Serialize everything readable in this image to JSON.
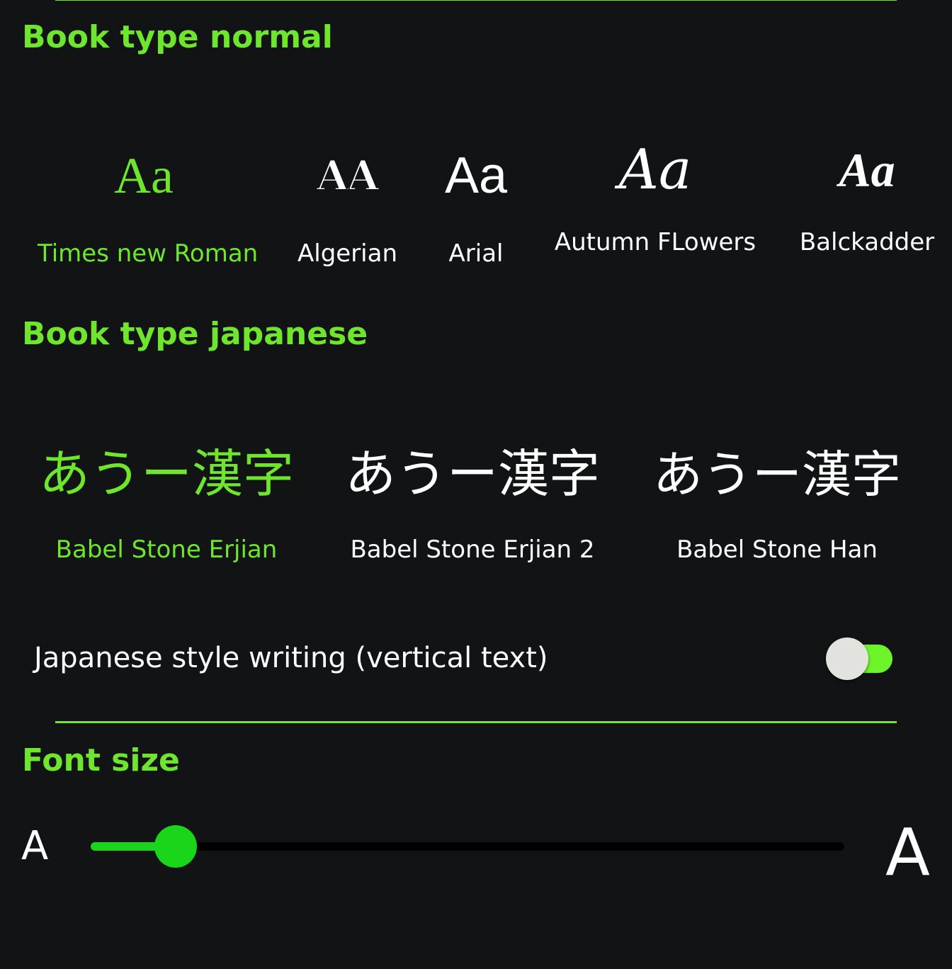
{
  "book_type_normal": {
    "title": "Book type normal",
    "options": [
      {
        "sample": "Aa",
        "label": "Times new Roman",
        "selected": true
      },
      {
        "sample": "AA",
        "label": "Algerian",
        "selected": false
      },
      {
        "sample": "Aa",
        "label": "Arial",
        "selected": false
      },
      {
        "sample": "Aa",
        "label": "Autumn FLowers",
        "selected": false
      },
      {
        "sample": "Aa",
        "label": "Balckadder",
        "selected": false
      }
    ]
  },
  "book_type_japanese": {
    "title": "Book type japanese",
    "options": [
      {
        "sample": "あうー漢字",
        "label": "Babel Stone Erjian",
        "selected": true
      },
      {
        "sample": "あうー漢字",
        "label": "Babel Stone Erjian 2",
        "selected": false
      },
      {
        "sample": "あうー漢字",
        "label": "Babel Stone Han",
        "selected": false
      }
    ],
    "vertical_text_toggle": {
      "label": "Japanese style writing (vertical text)",
      "on": true
    }
  },
  "font_size": {
    "title": "Font size",
    "min_glyph": "A",
    "max_glyph": "A",
    "slider_value": 0.113
  },
  "colors": {
    "accent": "#6ee62e",
    "background": "#111314",
    "slider": "#1ad61a",
    "toggle_track": "#6ef52a",
    "toggle_thumb": "#e2e2df"
  }
}
